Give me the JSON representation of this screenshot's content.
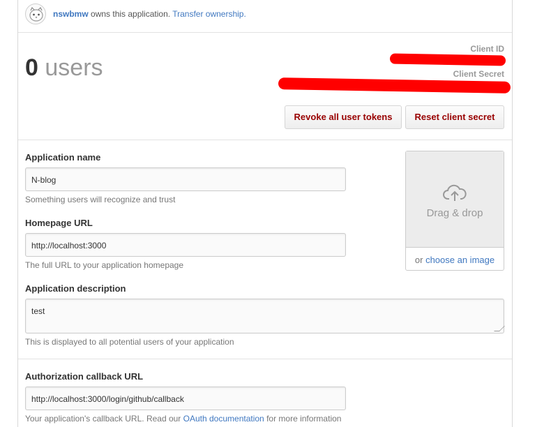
{
  "owner": {
    "username": "nswbmw",
    "text": "owns this application.",
    "transfer_link": "Transfer ownership."
  },
  "stats": {
    "user_count": "0",
    "user_label": "users",
    "client_id_label": "Client ID",
    "client_secret_label": "Client Secret"
  },
  "actions": {
    "revoke_label": "Revoke all user tokens",
    "reset_label": "Reset client secret"
  },
  "form": {
    "app_name_label": "Application name",
    "app_name_value": "N-blog",
    "app_name_help": "Something users will recognize and trust",
    "homepage_label": "Homepage URL",
    "homepage_value": "http://localhost:3000",
    "homepage_help": "The full URL to your application homepage",
    "description_label": "Application description",
    "description_value": "test",
    "description_help": "This is displayed to all potential users of your application",
    "callback_label": "Authorization callback URL",
    "callback_value": "http://localhost:3000/login/github/callback",
    "callback_help_before": "Your application's callback URL. Read our",
    "callback_help_link": "OAuth documentation",
    "callback_help_after": "for more information"
  },
  "upload": {
    "drag_text": "Drag & drop",
    "or_text": "or",
    "choose_link": "choose an image"
  },
  "colors": {
    "link": "#4078c0",
    "danger_text": "#990000",
    "redaction": "#ff0000"
  }
}
